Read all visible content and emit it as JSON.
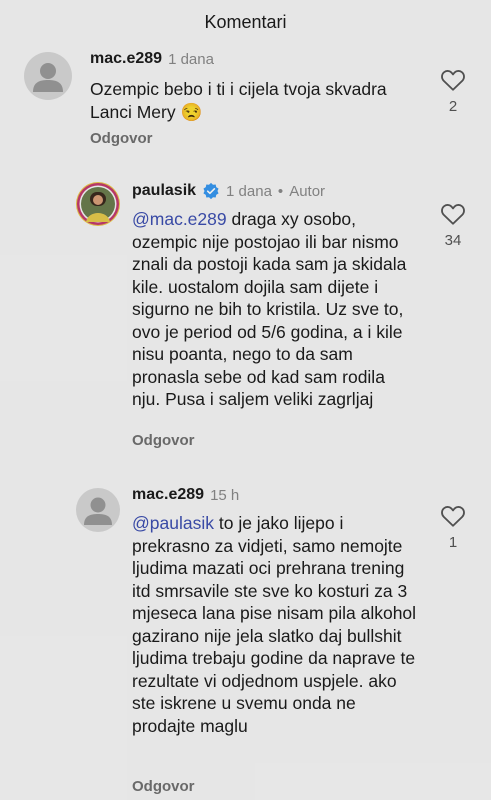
{
  "header": {
    "title": "Komentari"
  },
  "comments": [
    {
      "username": "mac.e289",
      "time": "1 dana",
      "text": "Ozempic bebo i ti i cijela tvoja skvadra Lanci Mery 😒",
      "reply_label": "Odgovor",
      "likes": "2"
    },
    {
      "username": "paulasik",
      "time": "1 dana",
      "author_label": "Autor",
      "mention": "@mac.e289",
      "text": "draga xy osobo, ozempic nije postojao ili bar nismo znali da postoji kada sam ja skidala kile. uostalom dojila sam dijete i sigurno ne bih to kristila. Uz sve to, ovo je period od 5/6 godina, a i kile nisu poanta, nego to da sam pronasla sebe od kad sam rodila nju. Pusa i saljem veliki zagrljaj",
      "reply_label": "Odgovor",
      "likes": "34"
    },
    {
      "username": "mac.e289",
      "time": "15 h",
      "mention": "@paulasik",
      "text": "to je jako lijepo i prekrasno za vidjeti, samo nemojte ljudima mazati oci prehrana trening itd smrsavile ste sve ko kosturi za 3 mjeseca lana pise nisam pila alkohol gazirano nije jela slatko daj bullshit ljudima trebaju godine da naprave te rezultate vi odjednom uspjele. ako ste iskrene u svemu onda ne prodajte maglu",
      "reply_label": "Odgovor",
      "likes": "1"
    }
  ],
  "colors": {
    "mention": "#3d4fb0",
    "verified": "#3897f0",
    "background": "#f5f5f5"
  }
}
